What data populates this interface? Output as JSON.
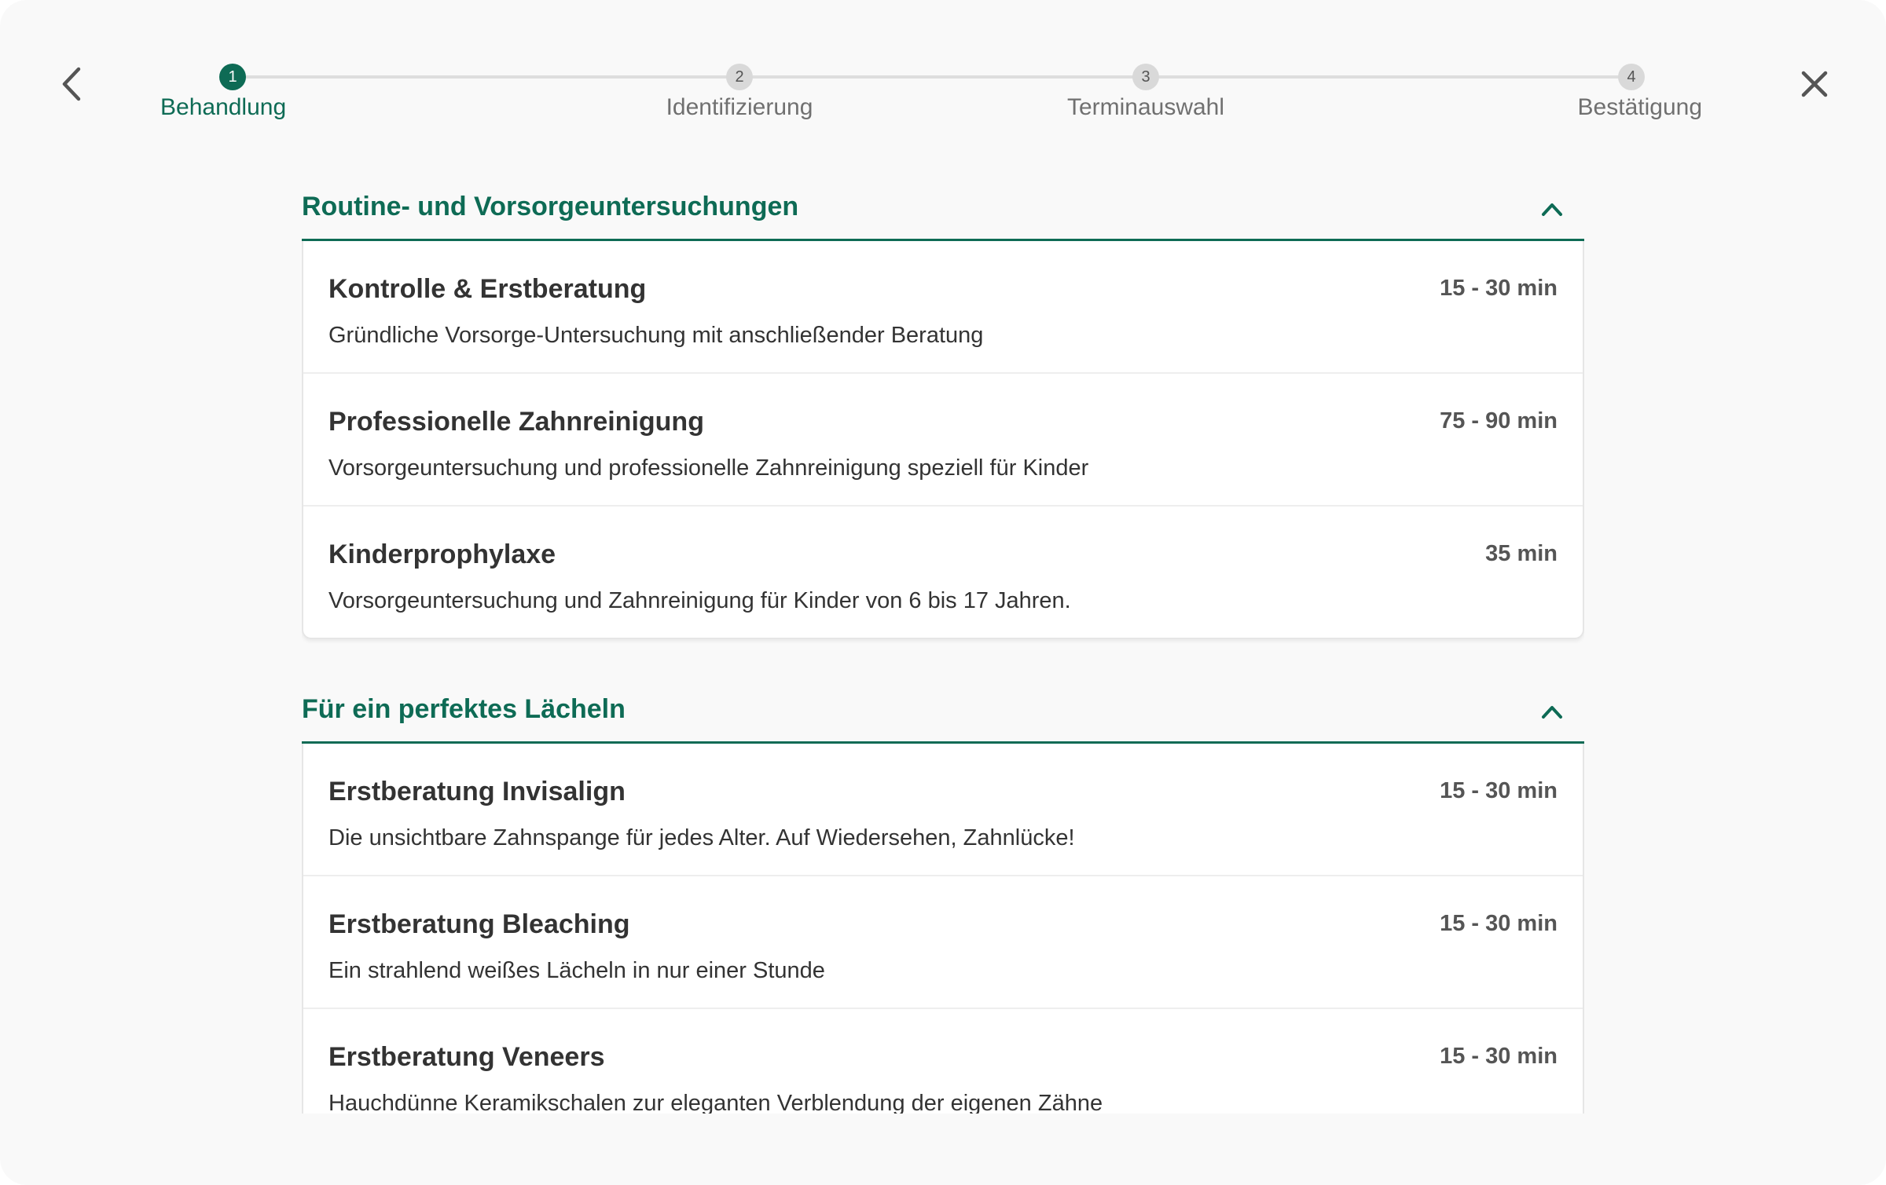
{
  "colors": {
    "accent": "#0e6b55",
    "background": "#f9f9f9",
    "card": "#ffffff",
    "step_inactive": "#d9d9d9"
  },
  "header": {
    "back_icon": "chevron-left-icon",
    "close_icon": "close-icon"
  },
  "stepper": {
    "active_step": 1,
    "steps": [
      {
        "number": "1",
        "label": "Behandlung"
      },
      {
        "number": "2",
        "label": "Identifizierung"
      },
      {
        "number": "3",
        "label": "Terminauswahl"
      },
      {
        "number": "4",
        "label": "Bestätigung"
      }
    ]
  },
  "sections": [
    {
      "title": "Routine- und Vorsorgeuntersuchungen",
      "expanded": true,
      "toggle_icon": "chevron-up-icon",
      "items": [
        {
          "title": "Kontrolle & Erstberatung",
          "duration": "15 - 30 min",
          "description": "Gründliche Vorsorge-Untersuchung mit anschließender Beratung"
        },
        {
          "title": "Professionelle Zahnreinigung",
          "duration": "75 - 90 min",
          "description": "Vorsorgeuntersuchung und professionelle Zahnreinigung speziell für Kinder"
        },
        {
          "title": "Kinderprophylaxe",
          "duration": "35 min",
          "description": "Vorsorgeuntersuchung und Zahnreinigung für Kinder von 6 bis 17 Jahren."
        }
      ]
    },
    {
      "title": "Für ein perfektes Lächeln",
      "expanded": true,
      "toggle_icon": "chevron-up-icon",
      "items": [
        {
          "title": "Erstberatung Invisalign",
          "duration": "15 - 30 min",
          "description": "Die unsichtbare Zahnspange für jedes Alter. Auf Wiedersehen, Zahnlücke!"
        },
        {
          "title": "Erstberatung Bleaching",
          "duration": "15 - 30 min",
          "description": "Ein strahlend weißes Lächeln in nur einer Stunde"
        },
        {
          "title": "Erstberatung Veneers",
          "duration": "15 - 30 min",
          "description": "Hauchdünne Keramikschalen zur eleganten Verblendung der eigenen Zähne"
        }
      ]
    }
  ]
}
